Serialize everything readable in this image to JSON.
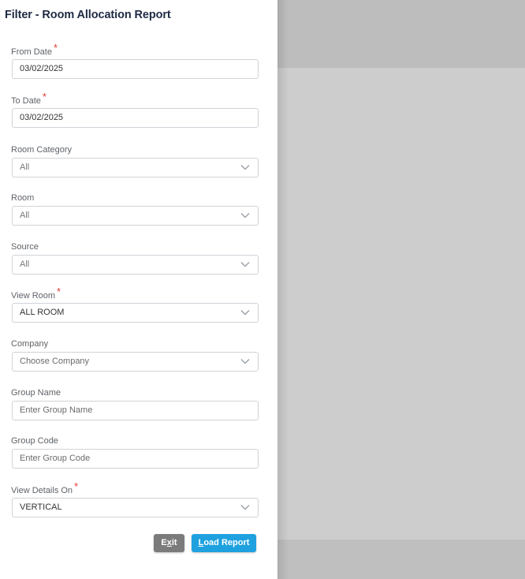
{
  "panel": {
    "title": "Filter - Room Allocation Report"
  },
  "fields": {
    "from_date": {
      "label": "From Date",
      "required": "*",
      "value": "03/02/2025"
    },
    "to_date": {
      "label": "To Date",
      "required": "*",
      "value": "03/02/2025"
    },
    "room_category": {
      "label": "Room Category",
      "value": "All",
      "icon": "chevron-down-icon"
    },
    "room": {
      "label": "Room",
      "value": "All",
      "icon": "chevron-down-icon"
    },
    "source": {
      "label": "Source",
      "value": "All",
      "icon": "chevron-down-icon"
    },
    "view_room": {
      "label": "View Room",
      "required": "*",
      "value": "ALL ROOM",
      "icon": "chevron-down-icon"
    },
    "company": {
      "label": "Company",
      "placeholder": "Choose Company",
      "icon": "chevron-down-icon"
    },
    "group_name": {
      "label": "Group Name",
      "placeholder": "Enter Group Name"
    },
    "group_code": {
      "label": "Group Code",
      "placeholder": "Enter Group Code"
    },
    "view_details_on": {
      "label": "View Details On",
      "required": "*",
      "value": "VERTICAL",
      "icon": "chevron-down-icon"
    }
  },
  "buttons": {
    "exit": {
      "pre": "E",
      "underlined": "x",
      "post": "it"
    },
    "load_report": {
      "pre": "",
      "underlined": "L",
      "post": "oad Report"
    }
  },
  "colors": {
    "title": "#1f2a44",
    "required": "#e53935",
    "exit_button": "#7b7b7b",
    "load_button": "#1fa1e0",
    "overlay": "#cdcdcd"
  }
}
